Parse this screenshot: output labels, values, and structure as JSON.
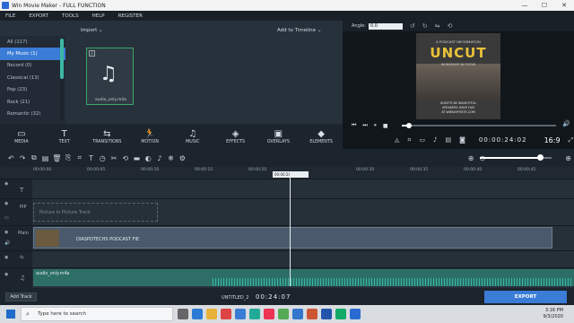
{
  "titlebar": {
    "title": "Win Movie Maker - FULL FUNCTION",
    "minimize": "—",
    "maximize": "☐",
    "close": "✕"
  },
  "menu": [
    "FILE",
    "EXPORT",
    "TOOLS",
    "HELP",
    "REGISTER"
  ],
  "library": {
    "categories": [
      {
        "label": "All (117)",
        "active": false
      },
      {
        "label": "My Music (1)",
        "active": true
      },
      {
        "label": "Record (0)",
        "active": false
      },
      {
        "label": "Classical (13)",
        "active": false
      },
      {
        "label": "Pop (23)",
        "active": false
      },
      {
        "label": "Rock (21)",
        "active": false
      },
      {
        "label": "Romantic (32)",
        "active": false
      }
    ],
    "import_label": "Import",
    "add_to_timeline": "Add to Timeline",
    "media": {
      "index": "2",
      "filename": "audio_only.m4a",
      "icon": "music-note-icon"
    }
  },
  "tools": [
    {
      "label": "MEDIA",
      "icon": "▭"
    },
    {
      "label": "TEXT",
      "icon": "T"
    },
    {
      "label": "TRANSITIONS",
      "icon": "⇆"
    },
    {
      "label": "MOTION",
      "icon": "🏃"
    },
    {
      "label": "MUSIC",
      "icon": "♫"
    },
    {
      "label": "EFFECTS",
      "icon": "◈"
    },
    {
      "label": "OVERLAYS",
      "icon": "▣"
    },
    {
      "label": "ELEMENTS",
      "icon": "◆"
    }
  ],
  "preview": {
    "angle_label": "Angle:",
    "angle_value": "0.0",
    "frame": {
      "subtitle": "A PODCAST INFORMATION",
      "title": "UNCUT",
      "tagline": "WORKSHOP IN FOCUS",
      "lines": [
        "GUESTS BE INSIGHTFUL",
        "SPEAKERS HAVE FUN",
        "AT WWW.MYSITE.COM"
      ]
    },
    "progress_fraction": 0.04,
    "timecode": "00:00:24:02",
    "ratio": "16:9"
  },
  "ruler_ticks": [
    "00:00:00",
    "00:00:05",
    "00:00:10",
    "00:00:15",
    "00:00:20",
    "00:00:30",
    "00:00:35",
    "00:00:40",
    "00:00:45"
  ],
  "playhead_label": "00:00:24",
  "tracks": {
    "text_label": "T",
    "pip_label": "PIP",
    "pip_placeholder": "Picture In Picture Track",
    "main_label": "Main",
    "clip_name": "DIASPOTECHS PODCAST FIE",
    "audio_name": "audio_only.m4a"
  },
  "footer": {
    "add_track": "Add Track",
    "project_name": "UNTITLED_2",
    "project_time": "00:24:07",
    "export": "EXPORT"
  },
  "taskbar": {
    "search_placeholder": "Type here to search",
    "time": "3:16 PM",
    "date": "9/3/2020"
  }
}
